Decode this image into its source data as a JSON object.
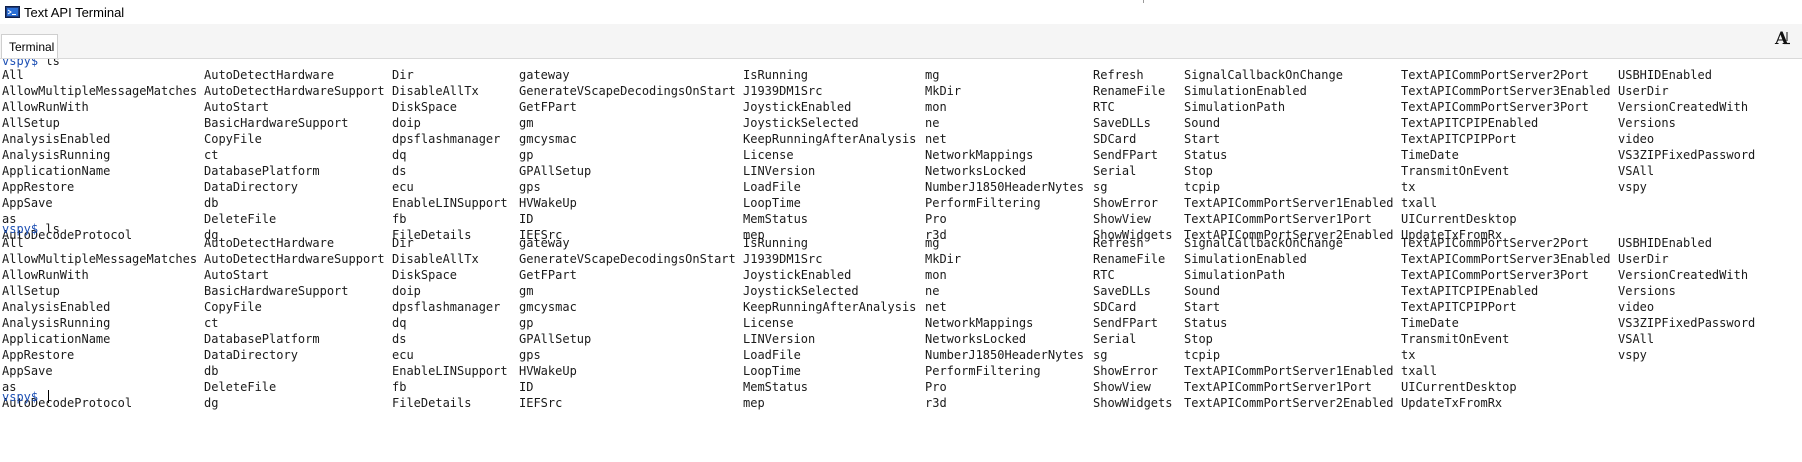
{
  "window": {
    "title": "Text API Terminal"
  },
  "tabs": [
    {
      "label": "Terminal",
      "active": true
    }
  ],
  "icons": {
    "app": "terminal-app-icon",
    "font": "font-size-icon"
  },
  "colors": {
    "prompt": "#1c4fb4",
    "text": "#1a1a1a"
  },
  "terminal": {
    "prompt": "vspy$",
    "commands": [
      {
        "command": "ls"
      },
      {
        "command": "ls"
      },
      {
        "command": ""
      }
    ],
    "listing": [
      [
        "All",
        "AllowMultipleMessageMatches",
        "AllowRunWith",
        "AllSetup",
        "AnalysisEnabled",
        "AnalysisRunning",
        "ApplicationName",
        "AppRestore",
        "AppSave",
        "as",
        "AutoDecodeProtocol"
      ],
      [
        "AutoDetectHardware",
        "AutoDetectHardwareSupport",
        "AutoStart",
        "BasicHardwareSupport",
        "CopyFile",
        "ct",
        "DatabasePlatform",
        "DataDirectory",
        "db",
        "DeleteFile",
        "dg"
      ],
      [
        "Dir",
        "DisableAllTx",
        "DiskSpace",
        "doip",
        "dpsflashmanager",
        "dq",
        "ds",
        "ecu",
        "EnableLINSupport",
        "fb",
        "FileDetails"
      ],
      [
        "gateway",
        "GenerateVScapeDecodingsOnStart",
        "GetFPart",
        "gm",
        "gmcysmac",
        "gp",
        "GPAllSetup",
        "gps",
        "HVWakeUp",
        "ID",
        "IEFSrc"
      ],
      [
        "IsRunning",
        "J1939DM1Src",
        "JoystickEnabled",
        "JoystickSelected",
        "KeepRunningAfterAnalysis",
        "License",
        "LINVersion",
        "LoadFile",
        "LoopTime",
        "MemStatus",
        "mep"
      ],
      [
        "mg",
        "MkDir",
        "mon",
        "ne",
        "net",
        "NetworkMappings",
        "NetworksLocked",
        "NumberJ1850HeaderNytes",
        "PerformFiltering",
        "Pro",
        "r3d"
      ],
      [
        "Refresh",
        "RenameFile",
        "RTC",
        "SaveDLLs",
        "SDCard",
        "SendFPart",
        "Serial",
        "sg",
        "ShowError",
        "ShowView",
        "ShowWidgets"
      ],
      [
        "SignalCallbackOnChange",
        "SimulationEnabled",
        "SimulationPath",
        "Sound",
        "Start",
        "Status",
        "Stop",
        "tcpip",
        "TextAPICommPortServer1Enabled",
        "TextAPICommPortServer1Port",
        "TextAPICommPortServer2Enabled"
      ],
      [
        "TextAPICommPortServer2Port",
        "TextAPICommPortServer3Enabled",
        "TextAPICommPortServer3Port",
        "TextAPITCPIPEnabled",
        "TextAPITCPIPPort",
        "TimeDate",
        "TransmitOnEvent",
        "tx",
        "txall",
        "UICurrentDesktop",
        "UpdateTxFromRx"
      ],
      [
        "USBHIDEnabled",
        "UserDir",
        "VersionCreatedWith",
        "Versions",
        "video",
        "VS3ZIPFixedPassword",
        "VSAll",
        "vspy"
      ]
    ]
  }
}
